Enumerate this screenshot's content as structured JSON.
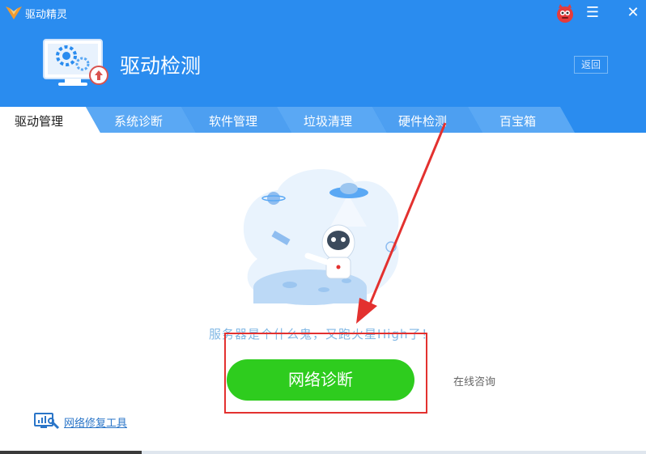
{
  "app": {
    "name": "驱动精灵"
  },
  "window_controls": {
    "menu": "☰",
    "close": "✕"
  },
  "header": {
    "title": "驱动检测",
    "back_label": "返回"
  },
  "tabs": [
    {
      "label": "驱动管理",
      "active": true
    },
    {
      "label": "系统诊断",
      "active": false
    },
    {
      "label": "软件管理",
      "active": false
    },
    {
      "label": "垃圾清理",
      "active": false
    },
    {
      "label": "硬件检测",
      "active": false
    },
    {
      "label": "百宝箱",
      "active": false
    }
  ],
  "main": {
    "slogan": "服务器是个什么鬼，又跑火星High了！",
    "diagnose_button": "网络诊断",
    "consult_link": "在线咨询",
    "repair_tool_link": "网络修复工具"
  },
  "colors": {
    "header_blue": "#2a8cef",
    "tab_light": "#5aa8f4",
    "button_green": "#2ecc1e",
    "annotation_red": "#e3312f",
    "link_blue": "#2a75c8"
  },
  "icons": {
    "app_logo": "app-logo-icon",
    "mascot": "mascot-icon",
    "header": "driver-monitor-icon",
    "repair": "network-repair-icon"
  }
}
